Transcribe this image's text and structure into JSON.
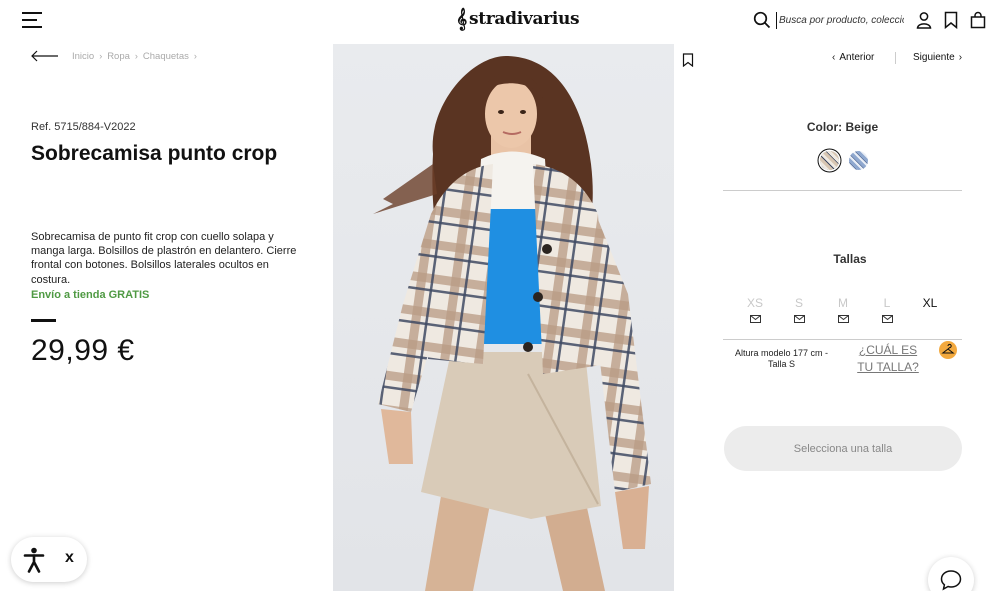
{
  "header": {
    "logo": "stradivarius",
    "search_placeholder": "Busca por producto, colección...",
    "icons": [
      "menu-icon",
      "search-icon",
      "user-icon",
      "bookmark-icon",
      "bag-icon"
    ]
  },
  "breadcrumb": {
    "items": [
      "Inicio",
      "Ropa",
      "Chaquetas"
    ],
    "separator": "›"
  },
  "product": {
    "ref": "Ref. 5715/884-V2022",
    "title": "Sobrecamisa punto crop",
    "description": "Sobrecamisa de punto fit crop con cuello solapa y manga larga. Bolsillos de plastrón en delantero. Cierre frontal con botones. Bolsillos laterales ocultos en costura.",
    "shipping": "Envío a tienda GRATIS",
    "price": "29,99 €"
  },
  "nav": {
    "prev_label": "Anterior",
    "next_label": "Siguiente"
  },
  "color": {
    "label": "Color: Beige",
    "swatches": [
      {
        "name": "Beige",
        "selected": true,
        "color": "#d8c6b2"
      },
      {
        "name": "Azul",
        "selected": false,
        "color": "#8fa8cf"
      }
    ]
  },
  "sizes": {
    "label": "Tallas",
    "items": [
      {
        "name": "XS",
        "available": false
      },
      {
        "name": "S",
        "available": false
      },
      {
        "name": "M",
        "available": false
      },
      {
        "name": "L",
        "available": false
      },
      {
        "name": "XL",
        "available": true
      }
    ],
    "model_info": "Altura modelo 177 cm - Talla S",
    "fit_link": "¿CUÁL ES TU TALLA?",
    "select_button": "Selecciona una talla"
  },
  "widgets": {
    "a11y_close": "x"
  },
  "colors": {
    "shipping_green": "#4f9a43",
    "hanger_orange": "#f3a93e",
    "button_gray": "#ececec"
  }
}
